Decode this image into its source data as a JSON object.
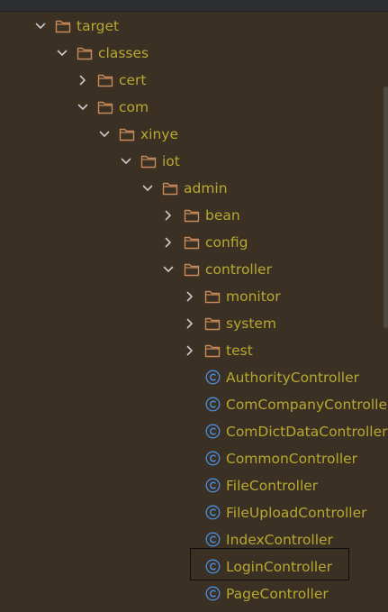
{
  "tree": {
    "nodes": [
      {
        "label": "target",
        "kind": "folder",
        "expanded": true
      },
      {
        "label": "classes",
        "kind": "folder",
        "expanded": true
      },
      {
        "label": "cert",
        "kind": "folder",
        "expanded": false
      },
      {
        "label": "com",
        "kind": "folder",
        "expanded": true
      },
      {
        "label": "xinye",
        "kind": "folder",
        "expanded": true
      },
      {
        "label": "iot",
        "kind": "folder",
        "expanded": true
      },
      {
        "label": "admin",
        "kind": "folder",
        "expanded": true
      },
      {
        "label": "bean",
        "kind": "folder",
        "expanded": false
      },
      {
        "label": "config",
        "kind": "folder",
        "expanded": false
      },
      {
        "label": "controller",
        "kind": "folder",
        "expanded": true
      },
      {
        "label": "monitor",
        "kind": "folder",
        "expanded": false
      },
      {
        "label": "system",
        "kind": "folder",
        "expanded": false
      },
      {
        "label": "test",
        "kind": "folder",
        "expanded": false
      },
      {
        "label": "AuthorityController",
        "kind": "class"
      },
      {
        "label": "ComCompanyController",
        "kind": "class"
      },
      {
        "label": "ComDictDataController",
        "kind": "class"
      },
      {
        "label": "CommonController",
        "kind": "class"
      },
      {
        "label": "FileController",
        "kind": "class"
      },
      {
        "label": "FileUploadController",
        "kind": "class"
      },
      {
        "label": "IndexController",
        "kind": "class"
      },
      {
        "label": "LoginController",
        "kind": "class",
        "highlighted": true
      },
      {
        "label": "PageController",
        "kind": "class"
      }
    ]
  },
  "colors": {
    "background": "#3a3024",
    "label": "#b8a832",
    "folder_outline": "#c98a5a",
    "class_icon": "#4c8fe0",
    "chevron": "#c9c9c9",
    "highlight_border": "#0e0e0e"
  },
  "icons": {
    "folder": "folder-icon",
    "class": "class-icon",
    "expanded": "chevron-down-icon",
    "collapsed": "chevron-right-icon"
  }
}
